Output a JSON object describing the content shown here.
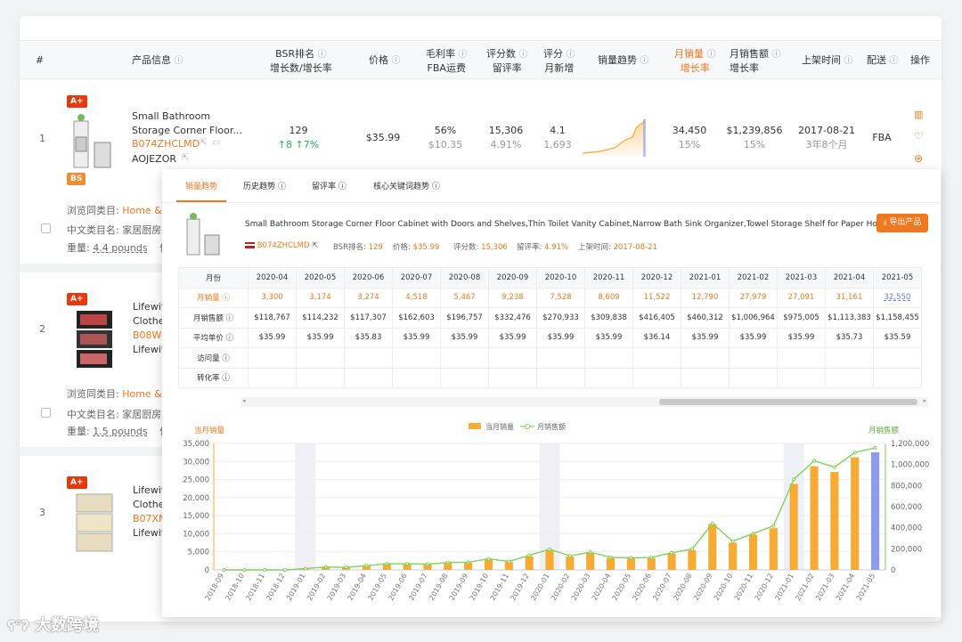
{
  "colors": {
    "accent": "#f0781e",
    "green": "#23b14d",
    "bar": "#f7ab32",
    "bar_highlight": "#8b9cf0",
    "line": "#7ed35a"
  },
  "table_header": {
    "index": "#",
    "product_info": "产品信息",
    "bsr": "BSR排名",
    "bsr_sub": "增长数/增长率",
    "price": "价格",
    "margin": "毛利率",
    "margin_sub": "FBA运费",
    "reviews": "评分数",
    "reviews_sub": "留评率",
    "rating": "评分",
    "rating_sub": "月新增",
    "trend": "销量趋势",
    "monthly_sales": "月销量",
    "monthly_sales_sub": "增长率",
    "monthly_revenue": "月销售额",
    "monthly_revenue_sub": "增长率",
    "listed": "上架时间",
    "delivery": "配送",
    "actions": "操作"
  },
  "rows": [
    {
      "num": "1",
      "badge1": "A+",
      "badge2": "BS",
      "title_line1": "Small Bathroom",
      "title_line2": "Storage Corner Floor...",
      "asin": "B074ZHCLMD",
      "brand": "AOJEZOR",
      "bsr": "129",
      "bsr_up1": "↑8",
      "bsr_up2": "↑7%",
      "price": "$35.99",
      "margin": "56%",
      "fba": "$10.35",
      "reviews": "15,306",
      "review_rate": "4.91%",
      "rating": "4.1",
      "rating_new": "1,693",
      "monthly_sales": "34,450",
      "sales_growth": "15%",
      "revenue": "$1,239,856",
      "revenue_growth": "15%",
      "listed": "2017-08-21",
      "listed_age": "3年8个月",
      "delivery": "FBA",
      "browse_label": "浏览同类目:",
      "browse_value": "Home & K",
      "cn_cat": "中文类目名: 家居厨房用",
      "weight_label": "重量:",
      "weight": "4.4 pounds",
      "vol": "体"
    },
    {
      "num": "2",
      "badge1": "A+",
      "title_line1": "Lifewit",
      "title_line2": "Clothe",
      "asin": "B08W4",
      "brand": "Lifewit",
      "browse_label": "浏览同类目:",
      "browse_value": "Home & K",
      "cn_cat": "中文类目名: 家居厨房用",
      "weight_label": "重量:",
      "weight": "1.5 pounds",
      "vol": "体"
    },
    {
      "num": "3",
      "badge1": "A+",
      "title_line1": "Lifewit",
      "title_line2": "Clothe",
      "asin": "B07XM",
      "brand": "Lifewit"
    }
  ],
  "popup": {
    "tabs": [
      "销量趋势",
      "历史趋势",
      "留评率",
      "核心关键词趋势"
    ],
    "title": "Small Bathroom Storage Corner Floor Cabinet with Doors and Shelves,Thin Toilet Vanity Cabinet,Narrow Bath Sink Organizer,Towel Storage Shelf for Paper Holder,W...",
    "export": "导出产品",
    "meta": {
      "asin": "B074ZHCLMD",
      "bsr_label": "BSR排名:",
      "bsr": "129",
      "price_label": "价格:",
      "price": "$35.99",
      "reviews_label": "评分数:",
      "reviews": "15,306",
      "rate_label": "留评率:",
      "rate": "4.91%",
      "listed_label": "上架时间:",
      "listed": "2017-08-21"
    },
    "month_table": {
      "row_labels": [
        "月份",
        "月销量",
        "月销售额",
        "平均单价",
        "访问量",
        "转化率"
      ],
      "months": [
        "2020-04",
        "2020-05",
        "2020-06",
        "2020-07",
        "2020-08",
        "2020-09",
        "2020-10",
        "2020-11",
        "2020-12",
        "2021-01",
        "2021-02",
        "2021-03",
        "2021-04",
        "2021-05"
      ],
      "sales": [
        "3,300",
        "3,174",
        "3,274",
        "4,518",
        "5,467",
        "9,238",
        "7,528",
        "8,609",
        "11,522",
        "12,790",
        "27,979",
        "27,091",
        "31,161",
        "32,550"
      ],
      "revenue": [
        "$118,767",
        "$114,232",
        "$117,307",
        "$162,603",
        "$196,757",
        "$332,476",
        "$270,933",
        "$309,838",
        "$416,405",
        "$460,312",
        "$1,006,964",
        "$975,005",
        "$1,113,383",
        "$1,158,455"
      ],
      "avg_price": [
        "$35.99",
        "$35.99",
        "$35.83",
        "$35.99",
        "$35.99",
        "$35.99",
        "$35.99",
        "$35.99",
        "$36.14",
        "$35.99",
        "$35.99",
        "$35.99",
        "$35.73",
        "$35.59"
      ]
    }
  },
  "chart_data": {
    "type": "bar",
    "ylabel_left": "当月销量",
    "ylabel_right": "月销售额",
    "legend": [
      "当月销量",
      "月销售额"
    ],
    "ylim_left": [
      0,
      35000
    ],
    "ylim_right": [
      0,
      1200000
    ],
    "left_ticks": [
      "0",
      "5,000",
      "10,000",
      "15,000",
      "20,000",
      "25,000",
      "30,000",
      "35,000"
    ],
    "right_ticks": [
      "0",
      "200,000",
      "400,000",
      "600,000",
      "800,000",
      "1,000,000",
      "1,200,000"
    ],
    "categories": [
      "2018-09",
      "2018-10",
      "2018-11",
      "2018-12",
      "2019-01",
      "2019-02",
      "2019-03",
      "2019-04",
      "2019-05",
      "2019-06",
      "2019-07",
      "2019-08",
      "2019-09",
      "2019-10",
      "2019-11",
      "2019-12",
      "2020-01",
      "2020-02",
      "2020-03",
      "2020-04",
      "2020-05",
      "2020-06",
      "2020-07",
      "2020-08",
      "2020-09",
      "2020-10",
      "2020-11",
      "2020-12",
      "2021-01",
      "2021-02",
      "2021-03",
      "2021-04",
      "2021-05"
    ],
    "series": [
      {
        "name": "当月销量",
        "values": [
          0,
          0,
          0,
          0,
          200,
          700,
          600,
          1100,
          1600,
          1600,
          1500,
          1900,
          2000,
          2900,
          2200,
          3800,
          5400,
          3700,
          4700,
          3300,
          3174,
          3274,
          4518,
          5467,
          12700,
          7528,
          9800,
          11522,
          23800,
          28700,
          27091,
          31161,
          32550
        ]
      },
      {
        "name": "月销售额",
        "values": [
          0,
          0,
          0,
          0,
          12000,
          28000,
          24000,
          40000,
          58000,
          58000,
          54000,
          70000,
          73000,
          105000,
          80000,
          138000,
          196000,
          133000,
          168000,
          118767,
          114232,
          117307,
          162603,
          196757,
          440000,
          270933,
          345000,
          416405,
          860000,
          1035000,
          975005,
          1113383,
          1158455
        ]
      }
    ]
  },
  "watermark": "大数跨境"
}
